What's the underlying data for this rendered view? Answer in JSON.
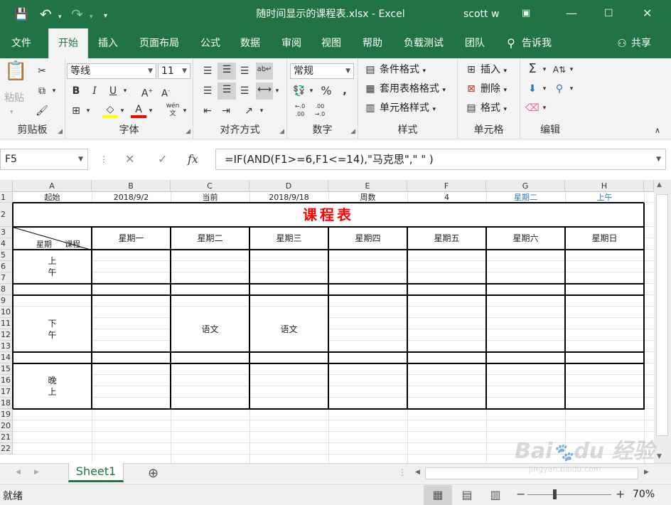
{
  "window": {
    "title": "随时间显示的课程表.xlsx  -  Excel",
    "user": "scott w"
  },
  "ribbon_tabs": [
    "文件",
    "开始",
    "插入",
    "页面布局",
    "公式",
    "数据",
    "审阅",
    "视图",
    "帮助",
    "负载测试",
    "团队"
  ],
  "tell_me": "告诉我",
  "share": "共享",
  "ribbon": {
    "clipboard": {
      "label": "剪贴板",
      "paste": "粘贴"
    },
    "font": {
      "label": "字体",
      "name": "等线",
      "size": "11",
      "phonetic": "wén"
    },
    "alignment": {
      "label": "对齐方式"
    },
    "number": {
      "label": "数字",
      "format": "常规"
    },
    "styles": {
      "label": "样式",
      "conditional": "条件格式",
      "table": "套用表格格式",
      "cell": "单元格样式"
    },
    "cells": {
      "label": "单元格",
      "insert": "插入",
      "delete": "删除",
      "format": "格式"
    },
    "editing": {
      "label": "编辑"
    }
  },
  "name_box": "F5",
  "formula": "=IF(AND(F1>=6,F1<=14),\"马克思\",\" \" )",
  "columns": [
    "A",
    "B",
    "C",
    "D",
    "E",
    "F",
    "G",
    "H"
  ],
  "rows": [
    "1",
    "2",
    "3",
    "4",
    "5",
    "6",
    "7",
    "8",
    "9",
    "10",
    "11",
    "12",
    "13",
    "14",
    "15",
    "16",
    "17",
    "18",
    "19",
    "20",
    "21",
    "22"
  ],
  "row1": [
    "起始",
    "2018/9/2",
    "当前",
    "2018/9/18",
    "周数",
    "4",
    "星期二",
    "上午"
  ],
  "row1_highlight_color": "#2e75b6",
  "schedule": {
    "title": "课程表",
    "title_color": "#ff0000",
    "corner_left": "星期",
    "corner_right": "课程",
    "days": [
      "星期一",
      "星期二",
      "星期三",
      "星期四",
      "星期五",
      "星期六",
      "星期日"
    ],
    "periods": [
      "上\n午",
      "下\n午",
      "晚\n上"
    ],
    "entries": {
      "c_afternoon": "语文",
      "d_afternoon": "语文"
    }
  },
  "sheet_tab": "Sheet1",
  "status": {
    "ready": "就绪",
    "zoom": "70%"
  },
  "watermark": {
    "brand": "Bai du 经验",
    "url": "jingyan.baidu.com"
  }
}
